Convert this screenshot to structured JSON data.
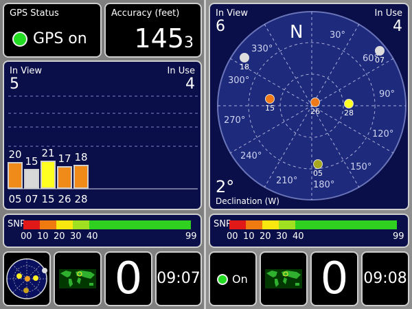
{
  "left": {
    "gps_status": {
      "label": "GPS Status",
      "value": "GPS on"
    },
    "accuracy": {
      "label": "Accuracy (feet)",
      "value": "145",
      "suffix": "3"
    },
    "signal": {
      "in_view_label": "In View",
      "in_view_value": "5",
      "in_use_label": "In Use",
      "in_use_value": "4"
    },
    "chart_data": {
      "type": "bar",
      "categories": [
        "05",
        "07",
        "15",
        "26",
        "28"
      ],
      "values": [
        20,
        15,
        21,
        17,
        18
      ],
      "colors": [
        "#f08a18",
        "#d8d8d8",
        "#ffff22",
        "#f08a18",
        "#f08a18"
      ],
      "ylim": [
        0,
        99
      ]
    },
    "snr": {
      "label": "SNR",
      "ticks": [
        "00",
        "10",
        "20",
        "30",
        "40"
      ],
      "max": "99"
    },
    "bottom": {
      "counter": "0",
      "clock": "09:07"
    }
  },
  "right": {
    "sky": {
      "in_view_label": "In View",
      "in_view_value": "6",
      "in_use_label": "In Use",
      "in_use_value": "4",
      "north": "N",
      "declination_value": "2°",
      "declination_label": "Declination (W)",
      "degree_labels": [
        "30°",
        "60°",
        "90°",
        "120°",
        "150°",
        "180°",
        "210°",
        "240°",
        "270°",
        "300°",
        "330°"
      ],
      "satellites": [
        {
          "id": "18",
          "color": "#dddddd"
        },
        {
          "id": "07",
          "color": "#dddddd"
        },
        {
          "id": "15",
          "color": "#f07a18"
        },
        {
          "id": "26",
          "color": "#f07a18"
        },
        {
          "id": "28",
          "color": "#ffff22"
        },
        {
          "id": "05",
          "color": "#a8a820"
        }
      ]
    },
    "snr": {
      "label": "SNR",
      "ticks": [
        "00",
        "10",
        "20",
        "30",
        "40"
      ],
      "max": "99"
    },
    "bottom": {
      "status": "On",
      "counter": "0",
      "clock": "09:08"
    }
  },
  "snr_colors": [
    "#e01818",
    "#ee7a10",
    "#f8e810",
    "#a0e020",
    "#30d020"
  ]
}
